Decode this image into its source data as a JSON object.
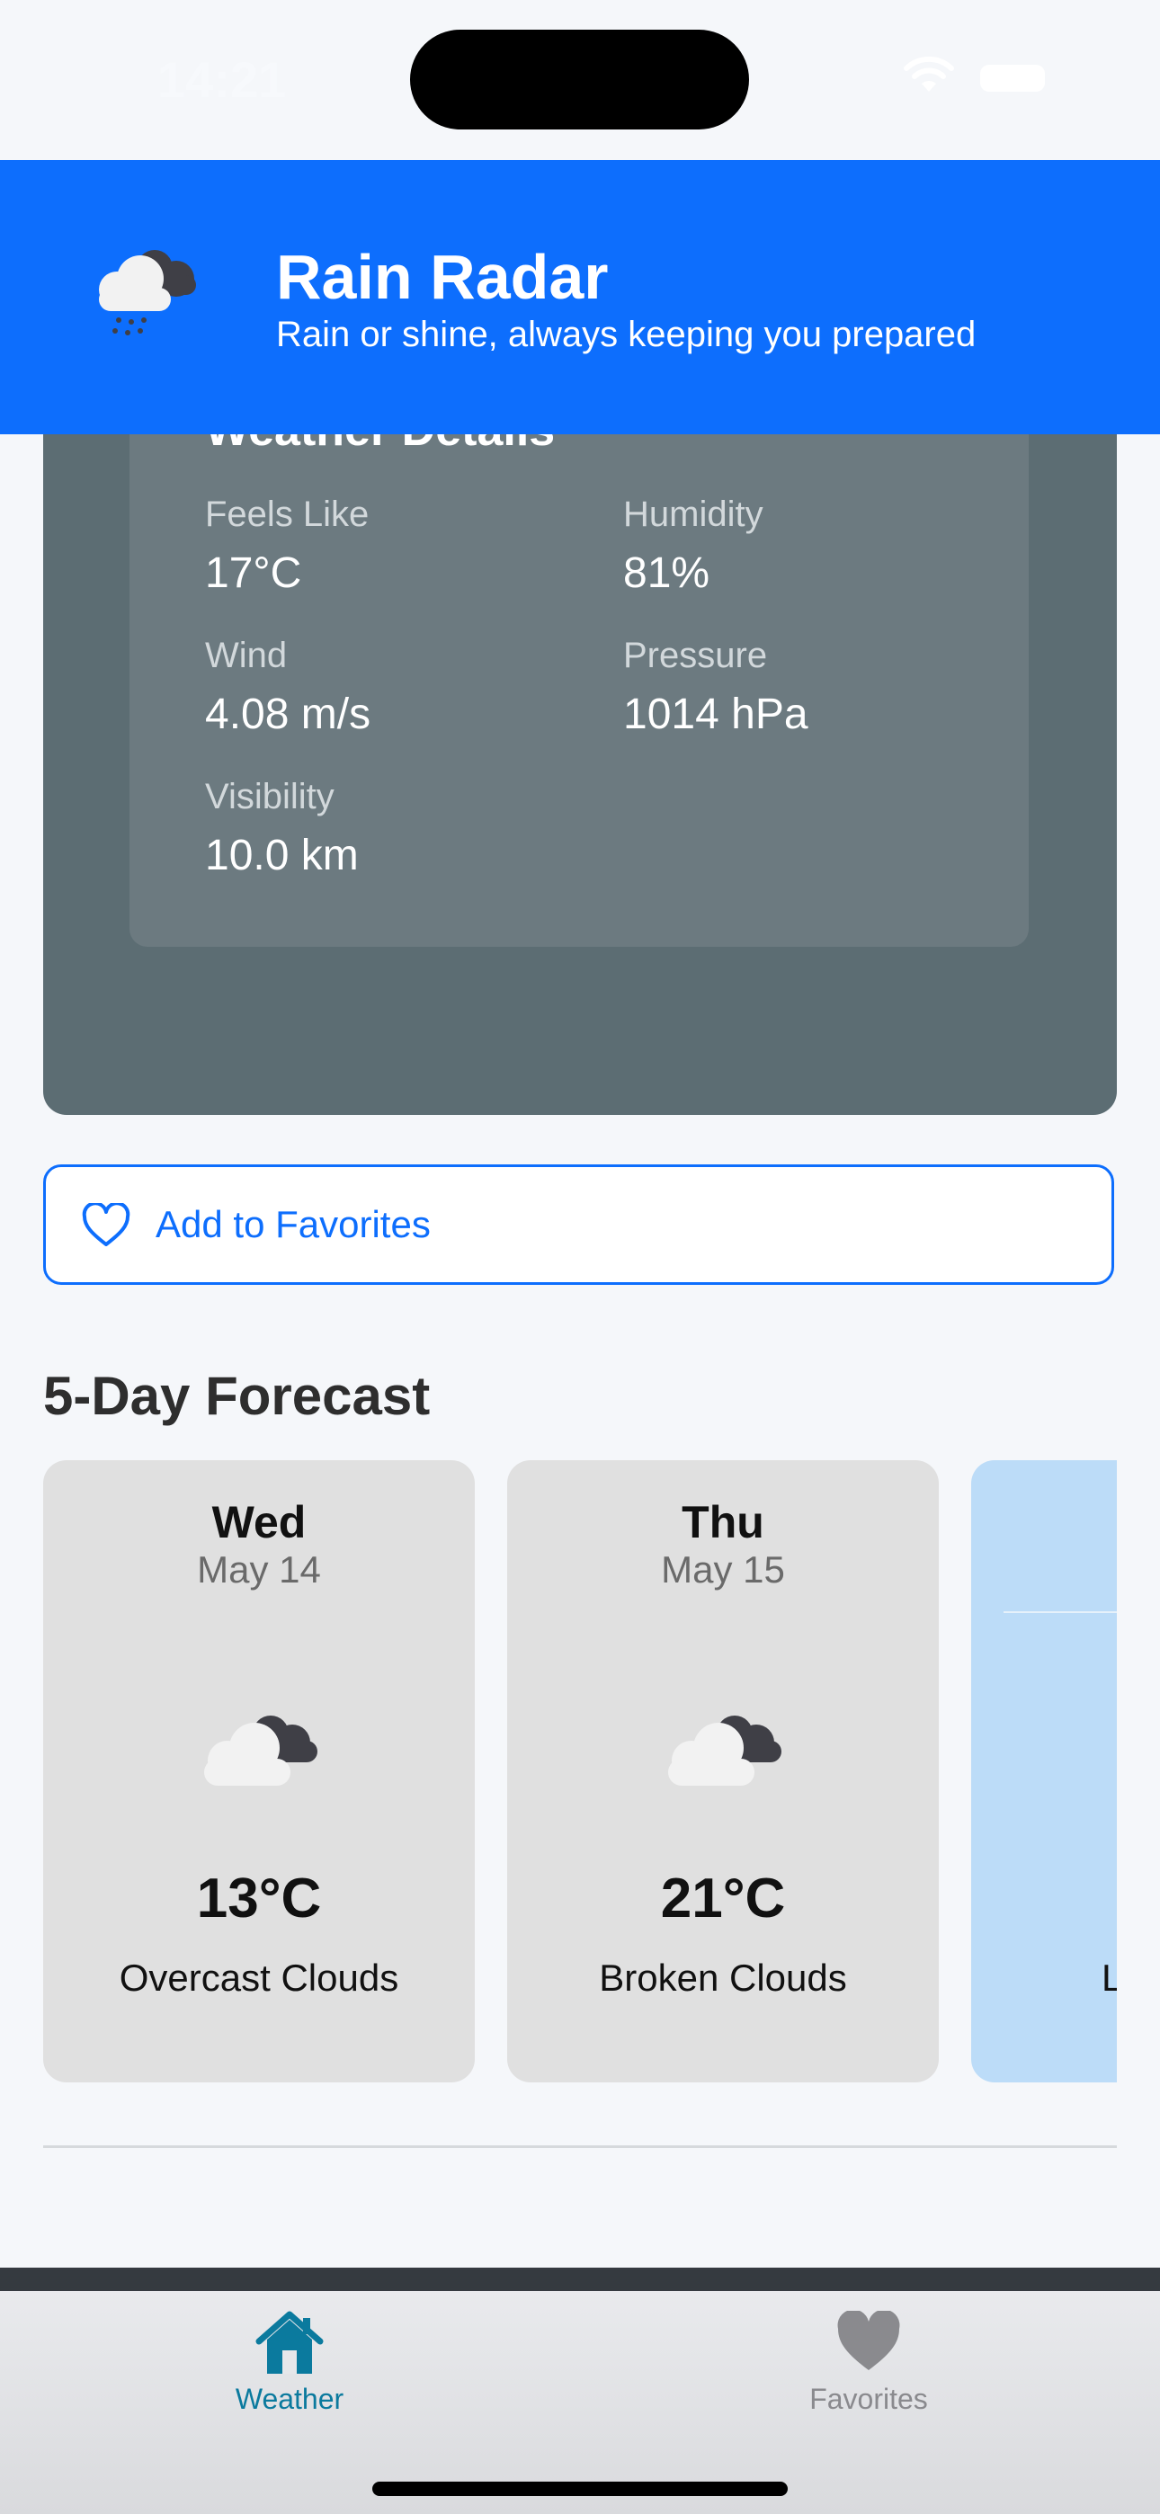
{
  "status_bar": {
    "time": "14:21"
  },
  "header": {
    "title": "Rain Radar",
    "subtitle": "Rain or shine, always keeping you prepared",
    "icon": "rain-cloud-icon"
  },
  "details": {
    "title": "Weather Details",
    "items": [
      {
        "label": "Feels Like",
        "value": "17°C"
      },
      {
        "label": "Humidity",
        "value": "81%"
      },
      {
        "label": "Wind",
        "value": "4.08 m/s"
      },
      {
        "label": "Pressure",
        "value": "1014 hPa"
      },
      {
        "label": "Visibility",
        "value": "10.0 km"
      }
    ]
  },
  "favorites_button": {
    "label": "Add to Favorites",
    "icon": "heart-outline-icon"
  },
  "forecast": {
    "title": "5-Day Forecast",
    "days": [
      {
        "day": "Wed",
        "date": "May 14",
        "temp": "13°C",
        "description": "Overcast Clouds",
        "icon": "overcast-clouds-icon"
      },
      {
        "day": "Thu",
        "date": "May 15",
        "temp": "21°C",
        "description": "Broken Clouds",
        "icon": "broken-clouds-icon"
      },
      {
        "partial_text": "L"
      }
    ]
  },
  "tab_bar": {
    "tabs": [
      {
        "label": "Weather",
        "icon": "house-icon",
        "color": "#0b7a9e"
      },
      {
        "label": "Favorites",
        "icon": "heart-icon",
        "color": "#8a8a8e"
      }
    ]
  },
  "colors": {
    "accent": "#0d6efd",
    "card": "#5c6d73",
    "panel": "#6c7a80"
  }
}
